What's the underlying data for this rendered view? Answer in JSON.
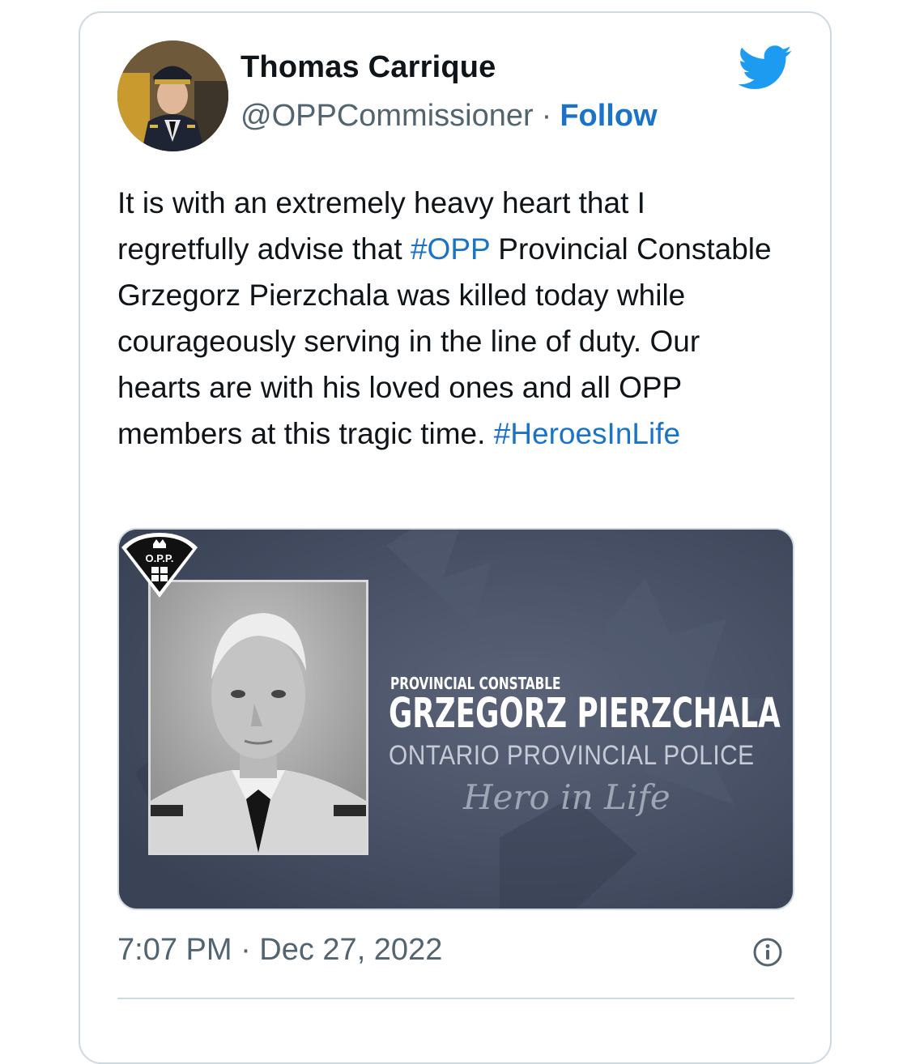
{
  "tweet": {
    "author_name": "Thomas Carrique",
    "handle": "@OPPCommissioner",
    "separator": "·",
    "follow_label": "Follow",
    "text_parts": [
      "It is with an extremely heavy heart that I regretfully advise that ",
      "#OPP",
      " Provincial Constable Grzegorz Pierzchala was killed today while courageously serving in the line of duty. Our hearts are with his loved ones and all OPP members at this tragic time. ",
      "#HeroesInLife"
    ],
    "timestamp": "7:07 PM · Dec 27, 2022",
    "icons": {
      "brand": "twitter-bird-icon",
      "info": "info-icon"
    }
  },
  "media": {
    "badge_label": "O.P.P.",
    "rank": "PROVINCIAL CONSTABLE",
    "officer_name": "GRZEGORZ PIERZCHALA",
    "force": "ONTARIO PROVINCIAL POLICE",
    "motto": "Hero in Life"
  },
  "colors": {
    "link": "#1a73c8",
    "twitter_blue": "#1d9bf0",
    "secondary_text": "#536471",
    "border": "#cfd9de",
    "media_background": "#4a5369"
  }
}
